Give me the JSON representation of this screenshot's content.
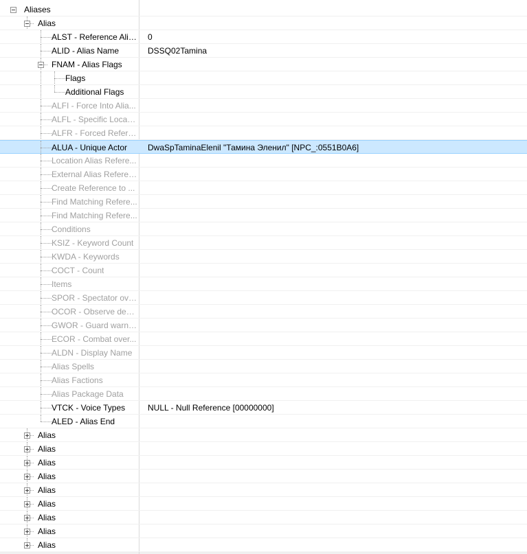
{
  "tree": {
    "nodes": [
      {
        "label": "Aliases",
        "value": "",
        "depth": 0,
        "expander": "minus",
        "disabled": false
      },
      {
        "label": "Alias",
        "value": "",
        "depth": 1,
        "expander": "minus",
        "disabled": false
      },
      {
        "label": "ALST - Reference Alia...",
        "value": "0",
        "depth": 2,
        "disabled": false
      },
      {
        "label": "ALID - Alias Name",
        "value": "DSSQ02Tamina",
        "depth": 2,
        "disabled": false
      },
      {
        "label": "FNAM - Alias Flags",
        "value": "",
        "depth": 2,
        "expander": "minus",
        "disabled": false
      },
      {
        "label": "Flags",
        "value": "",
        "depth": 3,
        "disabled": false
      },
      {
        "label": "Additional Flags",
        "value": "",
        "depth": 3,
        "disabled": false
      },
      {
        "label": "ALFI - Force Into Alia...",
        "value": "",
        "depth": 2,
        "disabled": true
      },
      {
        "label": "ALFL - Specific Locati...",
        "value": "",
        "depth": 2,
        "disabled": true
      },
      {
        "label": "ALFR - Forced Refere...",
        "value": "",
        "depth": 2,
        "disabled": true
      },
      {
        "label": "ALUA - Unique Actor",
        "value": "DwaSpTaminaElenil \"Тамина Эленил\" [NPC_:0551B0A6]",
        "depth": 2,
        "disabled": false,
        "selected": true
      },
      {
        "label": "Location Alias Refere...",
        "value": "",
        "depth": 2,
        "disabled": true
      },
      {
        "label": "External Alias Referen...",
        "value": "",
        "depth": 2,
        "disabled": true
      },
      {
        "label": "Create Reference to ...",
        "value": "",
        "depth": 2,
        "disabled": true
      },
      {
        "label": "Find Matching Refere...",
        "value": "",
        "depth": 2,
        "disabled": true
      },
      {
        "label": "Find Matching Refere...",
        "value": "",
        "depth": 2,
        "disabled": true
      },
      {
        "label": "Conditions",
        "value": "",
        "depth": 2,
        "disabled": true
      },
      {
        "label": "KSIZ - Keyword Count",
        "value": "",
        "depth": 2,
        "disabled": true
      },
      {
        "label": "KWDA - Keywords",
        "value": "",
        "depth": 2,
        "disabled": true
      },
      {
        "label": "COCT - Count",
        "value": "",
        "depth": 2,
        "disabled": true
      },
      {
        "label": "Items",
        "value": "",
        "depth": 2,
        "disabled": true
      },
      {
        "label": "SPOR - Spectator ove...",
        "value": "",
        "depth": 2,
        "disabled": true
      },
      {
        "label": "OCOR - Observe dea...",
        "value": "",
        "depth": 2,
        "disabled": true
      },
      {
        "label": "GWOR - Guard warn ...",
        "value": "",
        "depth": 2,
        "disabled": true
      },
      {
        "label": "ECOR - Combat over...",
        "value": "",
        "depth": 2,
        "disabled": true
      },
      {
        "label": "ALDN - Display Name",
        "value": "",
        "depth": 2,
        "disabled": true
      },
      {
        "label": "Alias Spells",
        "value": "",
        "depth": 2,
        "disabled": true
      },
      {
        "label": "Alias Factions",
        "value": "",
        "depth": 2,
        "disabled": true
      },
      {
        "label": "Alias Package Data",
        "value": "",
        "depth": 2,
        "disabled": true
      },
      {
        "label": "VTCK - Voice Types",
        "value": "NULL - Null Reference [00000000]",
        "depth": 2,
        "disabled": false
      },
      {
        "label": "ALED - Alias End",
        "value": "",
        "depth": 2,
        "disabled": false
      },
      {
        "label": "Alias",
        "value": "",
        "depth": 1,
        "expander": "plus",
        "disabled": false
      },
      {
        "label": "Alias",
        "value": "",
        "depth": 1,
        "expander": "plus",
        "disabled": false
      },
      {
        "label": "Alias",
        "value": "",
        "depth": 1,
        "expander": "plus",
        "disabled": false
      },
      {
        "label": "Alias",
        "value": "",
        "depth": 1,
        "expander": "plus",
        "disabled": false
      },
      {
        "label": "Alias",
        "value": "",
        "depth": 1,
        "expander": "plus",
        "disabled": false
      },
      {
        "label": "Alias",
        "value": "",
        "depth": 1,
        "expander": "plus",
        "disabled": false
      },
      {
        "label": "Alias",
        "value": "",
        "depth": 1,
        "expander": "plus",
        "disabled": false
      },
      {
        "label": "Alias",
        "value": "",
        "depth": 1,
        "expander": "plus",
        "disabled": false
      },
      {
        "label": "Alias",
        "value": "",
        "depth": 1,
        "expander": "plus",
        "disabled": false
      }
    ]
  },
  "colors": {
    "selection_background": "#cce8ff",
    "selection_border": "#99d1ff",
    "disabled_text": "#a0a0a0",
    "normal_text": "#000000",
    "tree_lines": "#a0a0a0"
  },
  "icons": {
    "expanded": "minus-box-icon",
    "collapsed": "plus-box-icon"
  }
}
